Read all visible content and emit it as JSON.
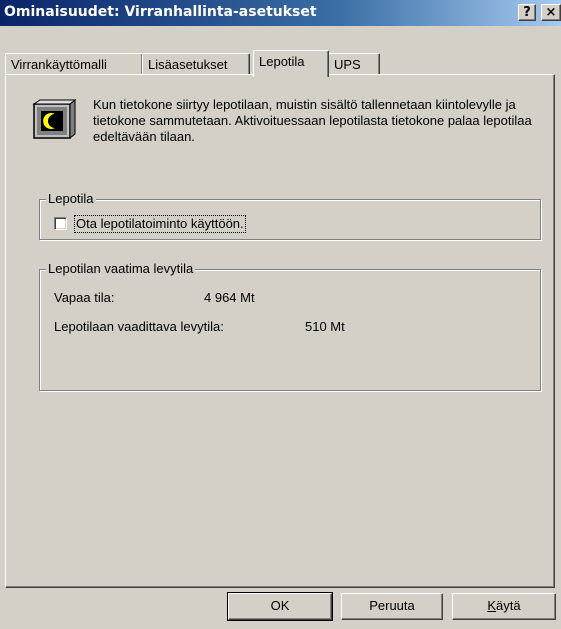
{
  "window": {
    "title": "Ominaisuudet: Virranhallinta-asetukset",
    "help_glyph": "?",
    "close_glyph": "×"
  },
  "tabs": [
    {
      "label": "Virrankäyttömalli",
      "active": false
    },
    {
      "label": "Lisäasetukset",
      "active": false
    },
    {
      "label": "Lepotila",
      "active": true
    },
    {
      "label": "UPS",
      "active": false
    }
  ],
  "hibernate": {
    "description": "Kun tietokone siirtyy lepotilaan, muistin sisältö tallennetaan kiintolevylle ja tietokone sammutetaan. Aktivoituessaan lepotilasta tietokone palaa lepotilaa edeltävään tilaan.",
    "icon": "monitor-moon-icon",
    "group_label": "Lepotila",
    "checkbox_label": "Ota lepotilatoiminto käyttöön.",
    "checkbox_checked": false
  },
  "disk": {
    "group_label": "Lepotilan vaatima levytila",
    "free_label": "Vapaa tila:",
    "free_value": "4 964 Mt",
    "required_label": "Lepotilaan vaadittava levytila:",
    "required_value": "510 Mt"
  },
  "buttons": {
    "ok": "OK",
    "cancel": "Peruuta",
    "apply_prefix": "K",
    "apply_rest": "äytä"
  },
  "colors": {
    "titlebar_start": "#0a246a",
    "titlebar_end": "#a6caf0",
    "face": "#d4d0c8"
  }
}
